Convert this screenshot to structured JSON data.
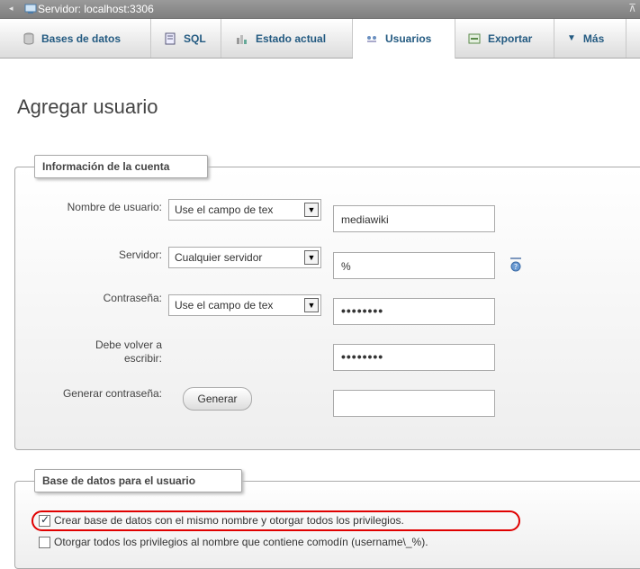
{
  "server_bar": {
    "label": "Servidor: localhost:3306"
  },
  "tabs": [
    {
      "label": "Bases de datos",
      "icon": "database-icon"
    },
    {
      "label": "SQL",
      "icon": "sql-icon"
    },
    {
      "label": "Estado actual",
      "icon": "status-icon"
    },
    {
      "label": "Usuarios",
      "icon": "users-icon",
      "active": true
    },
    {
      "label": "Exportar",
      "icon": "export-icon"
    },
    {
      "label": "Más",
      "icon": "chevron-down-icon"
    }
  ],
  "page": {
    "title": "Agregar usuario"
  },
  "account": {
    "legend": "Información de la cuenta",
    "username": {
      "label": "Nombre de usuario:",
      "select": "Use el campo de tex",
      "value": "mediawiki"
    },
    "host": {
      "label": "Servidor:",
      "select": "Cualquier servidor",
      "value": "%"
    },
    "password": {
      "label": "Contraseña:",
      "select": "Use el campo de tex",
      "value": "••••••••"
    },
    "retype": {
      "label_line1": "Debe volver a",
      "label_line2": "escribir:",
      "value": "••••••••"
    },
    "generate": {
      "label": "Generar contraseña:",
      "button": "Generar",
      "value": ""
    }
  },
  "database": {
    "legend": "Base de datos para el usuario",
    "options": [
      {
        "label": "Crear base de datos con el mismo nombre y otorgar todos los privilegios.",
        "checked": true
      },
      {
        "label": "Otorgar todos los privilegios al nombre que contiene comodín (username\\_%).",
        "checked": false
      }
    ]
  },
  "colors": {
    "tab_text": "#235a81",
    "highlight": "#e00000"
  }
}
